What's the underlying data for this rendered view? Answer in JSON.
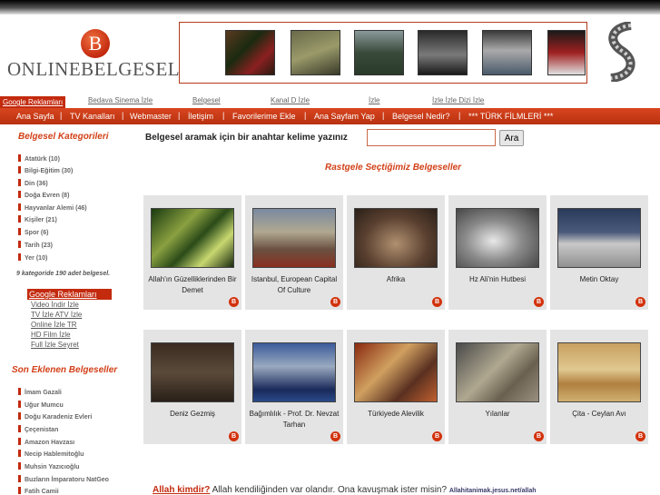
{
  "logo": {
    "letter": "B",
    "text": "ONLINEBELGESEL"
  },
  "top_ad_links": {
    "google": "Google Reklamları",
    "links": [
      "Bedava Sinema İzle",
      "Belgesel",
      "Kanal D İzle",
      "İzle",
      "İzle İzle Dizi İzle"
    ]
  },
  "nav": {
    "items": [
      "Ana Sayfa",
      "TV Kanalları",
      "Webmaster",
      "İletişim",
      "Favorilerime Ekle",
      "Ana Sayfam Yap",
      "Belgesel Nedir?",
      "*** TÜRK FİLMLERİ ***"
    ],
    "separator": "|"
  },
  "sidebar": {
    "categories_title": "Belgesel Kategorileri",
    "categories": [
      "Atatürk (10)",
      "Bilgi-Eğitim (30)",
      "Din (36)",
      "Doğa Evren (8)",
      "Hayvanlar Alemi (46)",
      "Kişiler (21)",
      "Spor (6)",
      "Tarih (23)",
      "Yer (10)"
    ],
    "summary": "9 kategoride 190 adet belgesel.",
    "ads_title": "Google Reklamları",
    "ads": [
      "Video İndir İzle",
      "TV İzle ATV İzle",
      "Online İzle TR",
      "HD Film İzle",
      "Full İzle Seyret"
    ],
    "recent_title": "Son Eklenen Belgeseller",
    "recent": [
      "İmam Gazali",
      "Uğur Mumcu",
      "Doğu Karadeniz Evleri",
      "Çeçenistan",
      "Amazon Havzası",
      "Necip Hablemitoğlu",
      "Muhsin Yazıcıoğlu",
      "Buzların İmparatoru NatGeo",
      "Fatih Camii"
    ]
  },
  "search": {
    "label": "Belgesel aramak için bir anahtar kelime yazınız",
    "value": "",
    "button": "Ara"
  },
  "random_title": "Rastgele Seçtiğimiz Belgeseller",
  "cards": [
    {
      "caption": "Allah'ın Güzelliklerinden Bir Demet"
    },
    {
      "caption": "Istanbul, European Capital Of Culture"
    },
    {
      "caption": "Afrika"
    },
    {
      "caption": "Hz Ali'nin Hutbesi"
    },
    {
      "caption": "Metin Oktay"
    },
    {
      "caption": "Deniz Gezmiş"
    },
    {
      "caption": "Bağımlılık - Prof. Dr. Nevzat Tarhan"
    },
    {
      "caption": "Türkiyede Alevilik"
    },
    {
      "caption": "Yılanlar"
    },
    {
      "caption": "Çita - Ceylan Avı"
    }
  ],
  "card_badge": "B",
  "footer": {
    "link": "Allah kimdir?",
    "text": " Allah kendiliğinden var olandır. Ona kavuşmak ister misin? ",
    "small": "Allahitanimak.jesus.net/allah"
  },
  "colors": {
    "accent": "#c32a0e",
    "heading": "#d24018"
  }
}
